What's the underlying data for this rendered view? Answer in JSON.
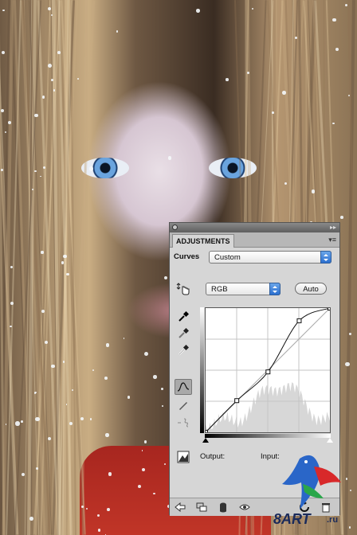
{
  "panel": {
    "tab_label": "ADJUSTMENTS",
    "adjustment_label": "Curves",
    "preset_value": "Custom",
    "channel_value": "RGB",
    "auto_label": "Auto",
    "output_label": "Output:",
    "input_label": "Input:"
  },
  "curve": {
    "points": [
      [
        0,
        0
      ],
      [
        64,
        65
      ],
      [
        128,
        124
      ],
      [
        192,
        229
      ],
      [
        255,
        255
      ]
    ]
  },
  "icons": {
    "hand": "on-image-adjust-icon",
    "eyedropper_black": "eyedropper-black-icon",
    "eyedropper_gray": "eyedropper-gray-icon",
    "eyedropper_white": "eyedropper-white-icon",
    "curve_tool": "curve-edit-icon",
    "pencil": "pencil-icon",
    "smooth": "smooth-curve-icon",
    "clipping": "clipping-warning-icon"
  },
  "watermark": {
    "brand": "8ART",
    "suffix": ".ru"
  }
}
